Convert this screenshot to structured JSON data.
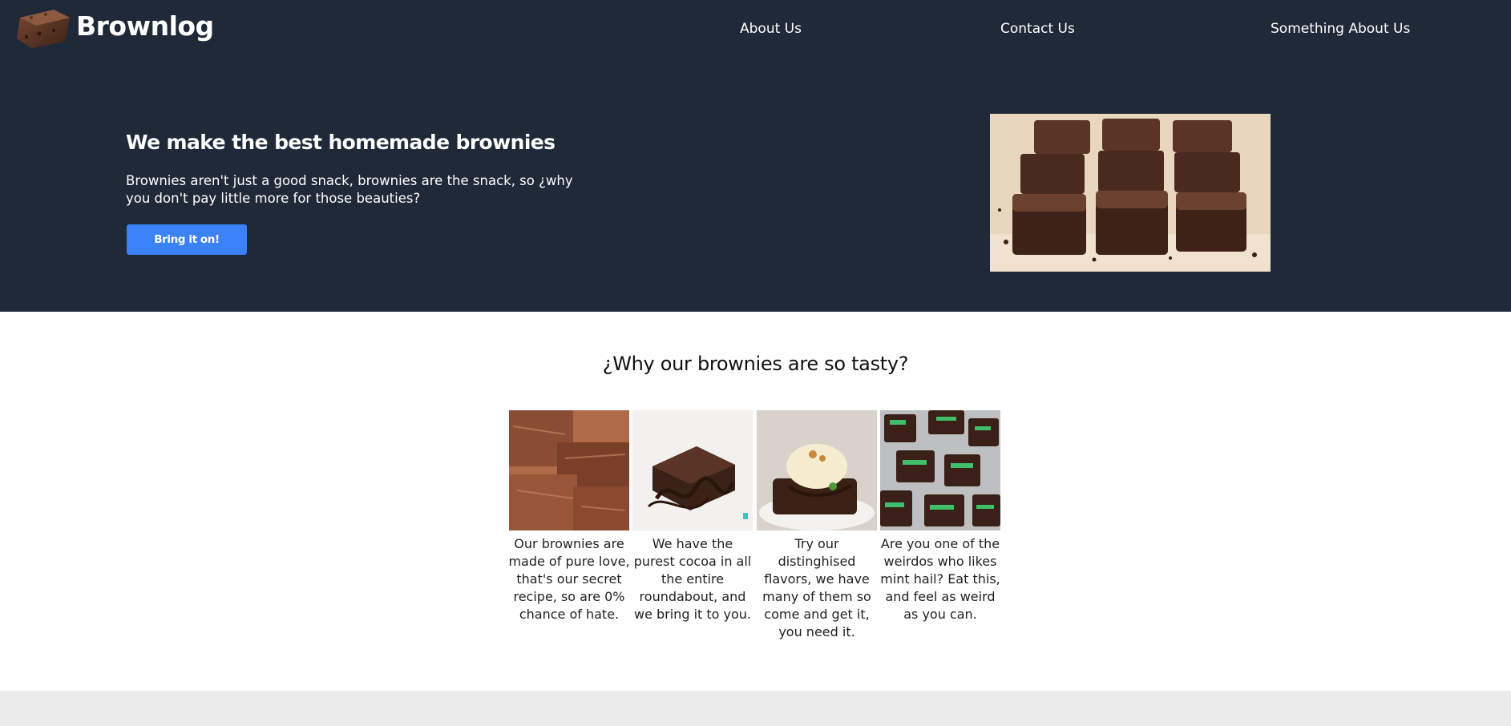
{
  "header": {
    "brand_name": "Brownlog",
    "logo_icon": "brownie-logo-icon",
    "nav": [
      {
        "label": "About Us"
      },
      {
        "label": "Contact Us"
      },
      {
        "label": "Something About Us"
      }
    ]
  },
  "hero": {
    "title": "We make the best homemade brownies",
    "text": "Brownies aren't just a good snack, brownies are the snack, so ¿why you don't pay little more for those beauties?",
    "cta_label": "Bring it on!"
  },
  "features": {
    "title": "¿Why our brownies are so tasty?",
    "items": [
      {
        "caption": "Our brownies are made of pure love, that's our secret recipe, so are 0% chance of hate."
      },
      {
        "caption": "We have the purest cocoa in all the entire roundabout, and we bring it to you."
      },
      {
        "caption": "Try our distinghised flavors, we have many of them so come and get it, you need it."
      },
      {
        "caption": "Are you one of the weirdos who likes mint hail? Eat this, and feel as weird as you can."
      }
    ]
  },
  "colors": {
    "header_bg": "#1f2937",
    "accent": "#3b82f6",
    "footer_bg": "#ebebeb"
  }
}
